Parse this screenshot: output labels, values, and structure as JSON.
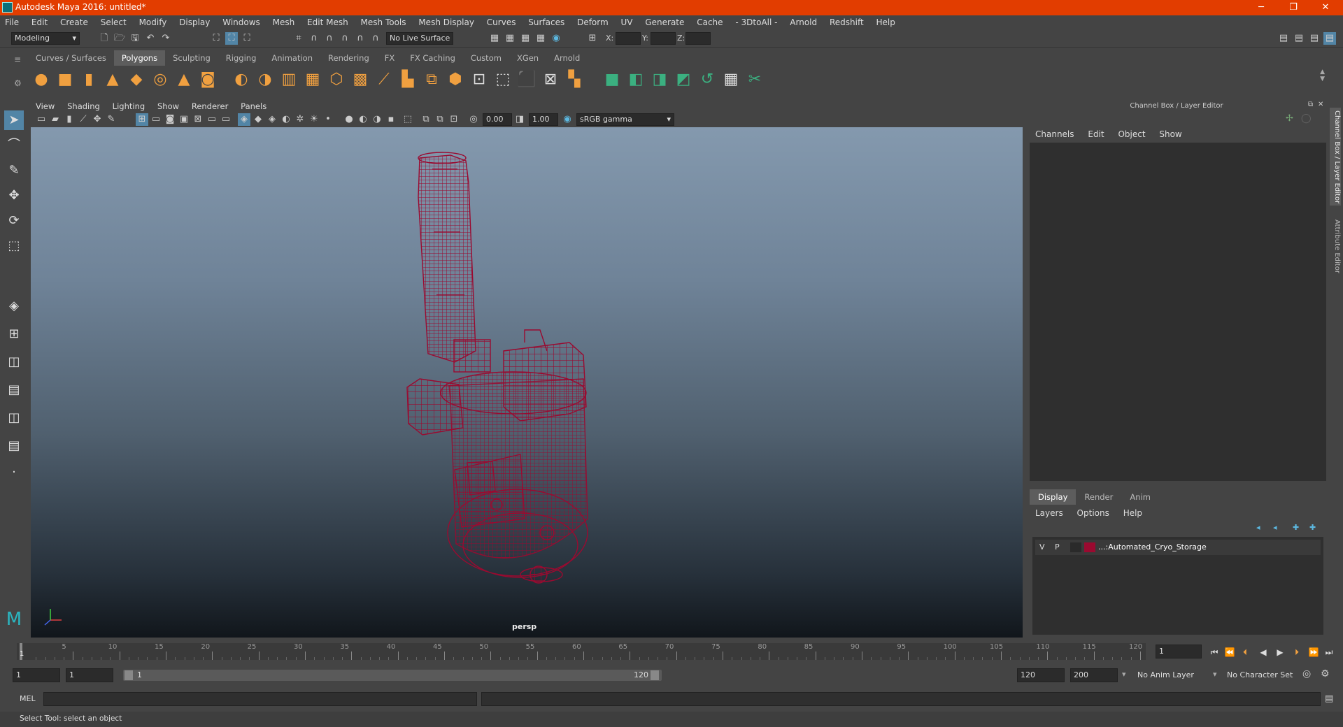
{
  "window": {
    "title": "Autodesk Maya 2016: untitled*",
    "minimize": "─",
    "restore": "❐",
    "close": "✕"
  },
  "menus": [
    "File",
    "Edit",
    "Create",
    "Select",
    "Modify",
    "Display",
    "Windows",
    "Mesh",
    "Edit Mesh",
    "Mesh Tools",
    "Mesh Display",
    "Curves",
    "Surfaces",
    "Deform",
    "UV",
    "Generate",
    "Cache",
    "- 3DtoAll -",
    "Arnold",
    "Redshift",
    "Help"
  ],
  "status": {
    "mode": "Modeling",
    "live_surface": "No Live Surface",
    "x_label": "X:",
    "y_label": "Y:",
    "z_label": "Z:"
  },
  "shelf_tabs": [
    "Curves / Surfaces",
    "Polygons",
    "Sculpting",
    "Rigging",
    "Animation",
    "Rendering",
    "FX",
    "FX Caching",
    "Custom",
    "XGen",
    "Arnold"
  ],
  "shelf_active": "Polygons",
  "viewport": {
    "menus": [
      "View",
      "Shading",
      "Lighting",
      "Show",
      "Renderer",
      "Panels"
    ],
    "exposure": "0.00",
    "gamma": "1.00",
    "color_space": "sRGB gamma",
    "camera": "persp"
  },
  "channel_box": {
    "title": "Channel Box / Layer Editor",
    "menus": [
      "Channels",
      "Edit",
      "Object",
      "Show"
    ]
  },
  "layer_editor": {
    "tabs": [
      "Display",
      "Render",
      "Anim"
    ],
    "active": "Display",
    "menus": [
      "Layers",
      "Options",
      "Help"
    ],
    "layer": {
      "v": "V",
      "p": "P",
      "name": "...:Automated_Cryo_Storage",
      "color": "#9a0a30"
    }
  },
  "side_tabs": [
    "Channel Box / Layer Editor",
    "Attribute Editor"
  ],
  "timeline": {
    "ticks": [
      "5",
      "10",
      "15",
      "20",
      "25",
      "30",
      "35",
      "40",
      "45",
      "50",
      "55",
      "60",
      "65",
      "70",
      "75",
      "80",
      "85",
      "90",
      "95",
      "100",
      "105",
      "110",
      "115",
      "120"
    ],
    "start_marker": "1",
    "current": "1"
  },
  "range": {
    "start": "1",
    "playback_start": "1",
    "range_start": "1",
    "range_end": "120",
    "playback_end": "120",
    "end": "200",
    "anim_layer": "No Anim Layer",
    "char_set": "No Character Set"
  },
  "command": {
    "label": "MEL"
  },
  "help": {
    "text": "Select Tool: select an object"
  },
  "colors": {
    "titlebar": "#e23d00",
    "wireframe": "#9a0a30",
    "accent": "#5285a6"
  }
}
